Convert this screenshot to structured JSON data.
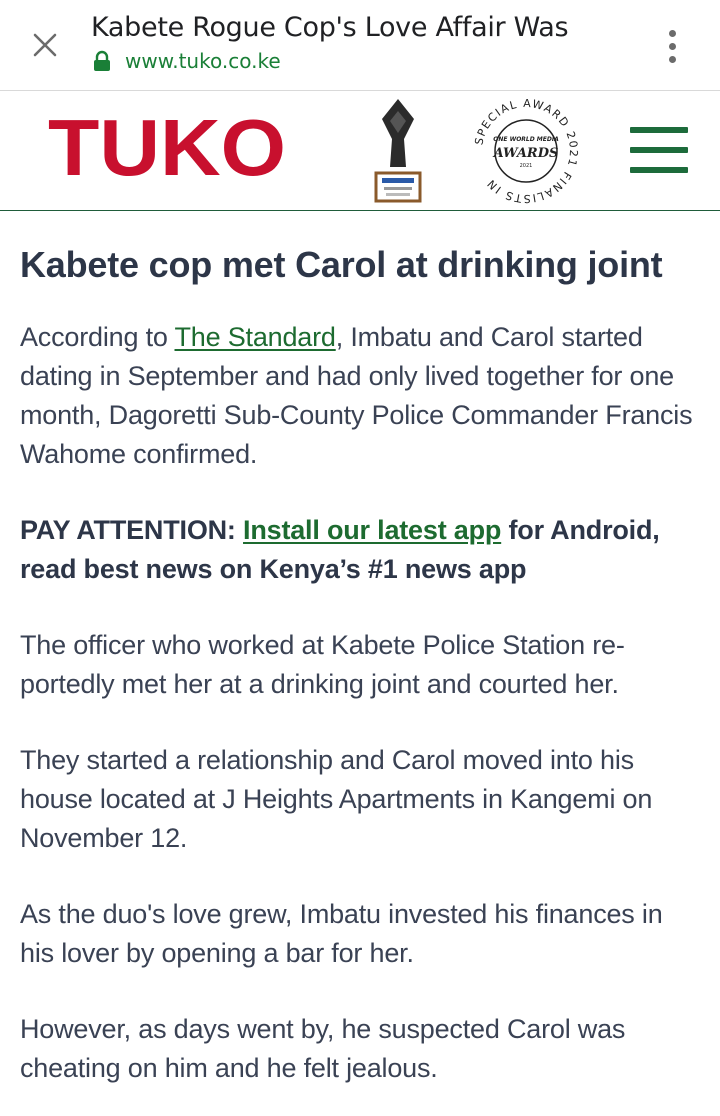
{
  "browser": {
    "page_title": "Kabete Rogue Cop's Love Affair Was",
    "url": "www.tuko.co.ke",
    "close_icon": "close-icon",
    "menu_icon": "more-vert-icon",
    "lock_icon": "lock-icon"
  },
  "site": {
    "logo_text": "TUKO",
    "brand_color": "#c8102e",
    "accent_color": "#1d6b3b",
    "award_badge": {
      "top_text": "AWARD 2021",
      "center_top": "ONE WORLD MEDIA",
      "center_main": "AWARDS",
      "center_year": "2021",
      "ring_text": "SPECIAL AWARD 2021 FINALISTS IN"
    }
  },
  "article": {
    "headline": "Kabete cop met Carol at drinking joint",
    "p1_pre": "According to ",
    "p1_link": "The Standard",
    "p1_post": ", Imbatu and Carol started dating in September and had only lived to­gether for one month, Dagoretti Sub-County Police Commander Francis Wahome confirmed.",
    "promo_pre": "PAY ATTENTION: ",
    "promo_link": "Install our latest app",
    "promo_post": " for Android, read best news on Kenya’s #1 news app",
    "p2": "The officer who worked at Kabete Police Station re­portedly met her at a drinking joint and courted her.",
    "p3": "They started a relationship and Carol moved into his house located at J Heights Apartments in Kangemi on November 12.",
    "p4": "As the duo's love grew, Imbatu invested his finances in his lover by opening a bar for her.",
    "p5": "However, as days went by, he suspected Carol was cheating on him and he felt jealous."
  }
}
